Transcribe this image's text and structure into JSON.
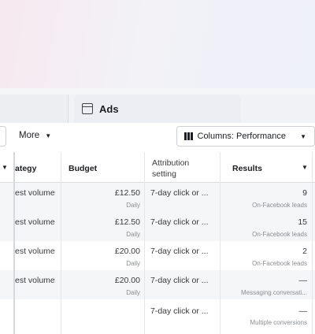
{
  "tabs": {
    "ads_label": "Ads"
  },
  "toolbar": {
    "more_label": "More",
    "columns_label": "Columns: Performance"
  },
  "table": {
    "headers": {
      "strategy": "ategy",
      "budget": "Budget",
      "attribution_line1": "Attribution",
      "attribution_line2": "setting",
      "results": "Results"
    },
    "rows": [
      {
        "strategy": "est volume",
        "budget": "£12.50",
        "budget_sub": "Daily",
        "attribution": "7-day click or ...",
        "results": "9",
        "results_sub": "On-Facebook leads"
      },
      {
        "strategy": "est volume",
        "budget": "£12.50",
        "budget_sub": "Daily",
        "attribution": "7-day click or ...",
        "results": "15",
        "results_sub": "On-Facebook leads"
      },
      {
        "strategy": "est volume",
        "budget": "£20.00",
        "budget_sub": "Daily",
        "attribution": "7-day click or ...",
        "results": "2",
        "results_sub": "On-Facebook leads"
      },
      {
        "strategy": "est volume",
        "budget": "£20.00",
        "budget_sub": "Daily",
        "attribution": "7-day click or ...",
        "results": "—",
        "results_sub": "Messaging conversati..."
      },
      {
        "strategy": "",
        "budget": "",
        "budget_sub": "",
        "attribution": "7-day click or ...",
        "results": "—",
        "results_sub": "Multiple conversions"
      }
    ]
  },
  "icons": {
    "ads_tab": "ad-card-icon",
    "columns": "columns-bars-icon",
    "caret": "caret-down-icon"
  }
}
